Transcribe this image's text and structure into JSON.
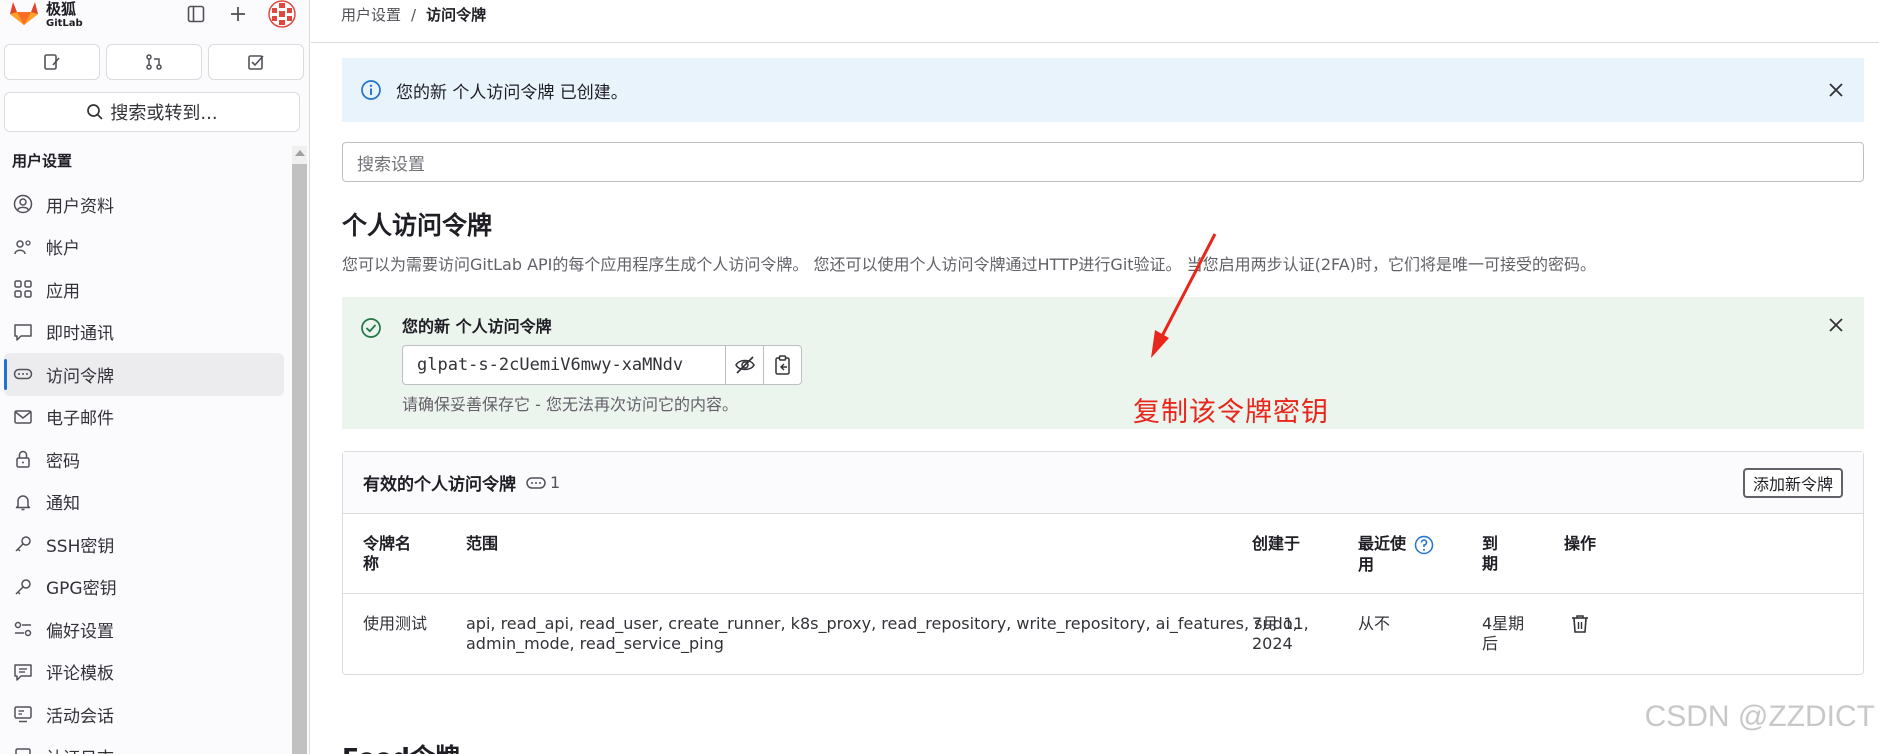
{
  "brand": {
    "name": "极狐",
    "sub": "GitLab"
  },
  "sidebar": {
    "search_label": "搜索或转到...",
    "section_title": "用户设置",
    "items": [
      {
        "label": "用户资料",
        "icon": "user-circle-icon"
      },
      {
        "label": "帐户",
        "icon": "account-settings-icon"
      },
      {
        "label": "应用",
        "icon": "applications-grid-icon"
      },
      {
        "label": "即时通讯",
        "icon": "chat-icon"
      },
      {
        "label": "访问令牌",
        "icon": "token-icon"
      },
      {
        "label": "电子邮件",
        "icon": "mail-icon"
      },
      {
        "label": "密码",
        "icon": "lock-icon"
      },
      {
        "label": "通知",
        "icon": "bell-icon"
      },
      {
        "label": "SSH密钥",
        "icon": "key-icon"
      },
      {
        "label": "GPG密钥",
        "icon": "key-icon"
      },
      {
        "label": "偏好设置",
        "icon": "preferences-icon"
      },
      {
        "label": "评论模板",
        "icon": "comment-template-icon"
      },
      {
        "label": "活动会话",
        "icon": "monitor-icon"
      },
      {
        "label": "认证日志",
        "icon": "log-icon"
      }
    ]
  },
  "breadcrumb": {
    "parent": "用户设置",
    "separator": "/",
    "current": "访问令牌"
  },
  "info_alert": {
    "text": "您的新 个人访问令牌 已创建。"
  },
  "settings_search": {
    "placeholder": "搜索设置"
  },
  "page": {
    "title": "个人访问令牌",
    "description": "您可以为需要访问GitLab API的每个应用程序生成个人访问令牌。 您还可以使用个人访问令牌通过HTTP进行Git验证。 当您启用两步认证(2FA)时，它们将是唯一可接受的密码。"
  },
  "success_alert": {
    "title": "您的新 个人访问令牌",
    "token": "glpat-s-2cUemiV6mwy-xaMNdv",
    "hint": "请确保妥善保存它 - 您无法再次访问它的内容。"
  },
  "annotation": {
    "text": "复制该令牌密钥",
    "color": "#e8261b"
  },
  "tokens_card": {
    "title": "有效的个人访问令牌",
    "count": "1",
    "add_button": "添加新令牌",
    "headers": {
      "name_line1": "令牌名",
      "name_line2": "称",
      "scopes": "范围",
      "created": "创建于",
      "last_used_line1": "最近使",
      "last_used_line2": "用",
      "expires_line1": "到",
      "expires_line2": "期",
      "actions": "操作"
    },
    "rows": [
      {
        "name": "使用测试",
        "scopes_line1": "api, read_api, read_user, create_runner, k8s_proxy, read_repository, write_repository, ai_features, sudo,",
        "scopes_line2": "admin_mode, read_service_ping",
        "created_line1": "7月 11,",
        "created_line2": "2024",
        "last_used": "从不",
        "expires_line1": "4星期",
        "expires_line2": "后"
      }
    ]
  },
  "next_section": {
    "title": "Feed令牌"
  },
  "watermark": "CSDN @ZZDICT"
}
